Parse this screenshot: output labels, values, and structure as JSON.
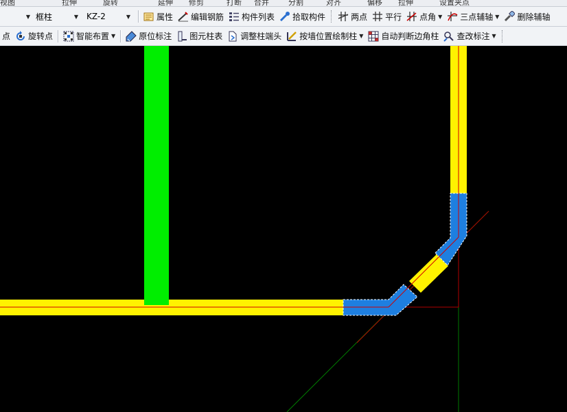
{
  "top_strip": {
    "items": [
      "视图",
      "拉伸",
      "旋转",
      "延伸",
      "修剪",
      "打断",
      "合并",
      "分割",
      "对齐",
      "偏移",
      "拉伸",
      "设置夹点"
    ]
  },
  "toolbar1": {
    "type_select": "框柱",
    "name_select": "KZ-2",
    "buttons": [
      {
        "label": "属性",
        "icon": "properties-icon"
      },
      {
        "label": "编辑钢筋",
        "icon": "edit-rebar-icon"
      },
      {
        "label": "构件列表",
        "icon": "component-list-icon"
      },
      {
        "label": "拾取构件",
        "icon": "pick-component-icon"
      },
      {
        "label": "两点",
        "icon": "two-point-axis-icon"
      },
      {
        "label": "平行",
        "icon": "parallel-axis-icon"
      },
      {
        "label": "点角",
        "icon": "point-angle-icon"
      },
      {
        "label": "三点辅轴",
        "icon": "three-point-axis-icon"
      },
      {
        "label": "删除辅轴",
        "icon": "delete-axis-icon"
      }
    ]
  },
  "toolbar2": {
    "buttons": [
      {
        "label": "点",
        "icon": "point-icon"
      },
      {
        "label": "旋转点",
        "icon": "rotate-point-icon"
      },
      {
        "label": "智能布置",
        "icon": "smart-layout-icon"
      },
      {
        "label": "原位标注",
        "icon": "in-place-annotation-icon"
      },
      {
        "label": "图元柱表",
        "icon": "column-table-icon"
      },
      {
        "label": "调整柱端头",
        "icon": "adjust-column-end-icon"
      },
      {
        "label": "按墙位置绘制柱",
        "icon": "draw-column-by-wall-icon"
      },
      {
        "label": "自动判断边角柱",
        "icon": "auto-corner-column-icon"
      },
      {
        "label": "查改标注",
        "icon": "check-annotation-icon"
      }
    ]
  },
  "colors": {
    "background": "#000000",
    "beam": "#FFF200",
    "beam_centerline": "#C8102E",
    "wall": "#00EE00",
    "selected_column": "#1E7FE0",
    "axis_red": "#B00000",
    "axis_green": "#007A00"
  }
}
